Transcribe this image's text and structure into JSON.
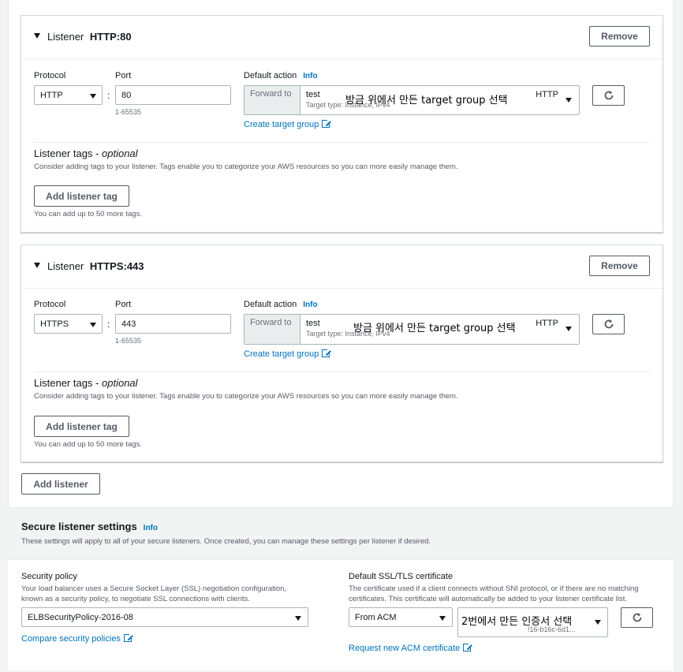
{
  "listeners": [
    {
      "title_prefix": "Listener",
      "title_main": "HTTP:80",
      "remove_label": "Remove",
      "protocol_label": "Protocol",
      "protocol_value": "HTTP",
      "port_label": "Port",
      "port_value": "80",
      "port_hint": "1-65535",
      "default_action_label": "Default action",
      "info_label": "Info",
      "forward_to_label": "Forward to",
      "target_group_name": "test",
      "target_group_sub": "Target type: Instance, IPv4",
      "target_group_protocol": "HTTP",
      "annotation": "방금 위에서 만든 target group 선택",
      "create_target_group_link": "Create target group",
      "tags_title": "Listener tags - ",
      "tags_optional": "optional",
      "tags_desc": "Consider adding tags to your listener. Tags enable you to categorize your AWS resources so you can more easily manage them.",
      "add_tag_label": "Add listener tag",
      "tags_hint": "You can add up to 50 more tags."
    },
    {
      "title_prefix": "Listener",
      "title_main": "HTTPS:443",
      "remove_label": "Remove",
      "protocol_label": "Protocol",
      "protocol_value": "HTTPS",
      "port_label": "Port",
      "port_value": "443",
      "port_hint": "1-65535",
      "default_action_label": "Default action",
      "info_label": "Info",
      "forward_to_label": "Forward to",
      "target_group_name": "test",
      "target_group_sub": "Target type: Instance, IPv4",
      "target_group_protocol": "HTTP",
      "annotation": "방금 위에서 만든 target group 선택",
      "create_target_group_link": "Create target group",
      "tags_title": "Listener tags - ",
      "tags_optional": "optional",
      "tags_desc": "Consider adding tags to your listener. Tags enable you to categorize your AWS resources so you can more easily manage them.",
      "add_tag_label": "Add listener tag",
      "tags_hint": "You can add up to 50 more tags."
    }
  ],
  "add_listener_label": "Add listener",
  "secure": {
    "title": "Secure listener settings",
    "info_label": "Info",
    "desc": "These settings will apply to all of your secure listeners. Once created, you can manage these settings per listener if desired.",
    "policy_label": "Security policy",
    "policy_desc_1": "Your load balancer uses a Secure Socket Layer (SSL) negotiation configuration,",
    "policy_desc_2": "known as a security policy, to negotiate SSL connections with clients.",
    "policy_value": "ELBSecurityPolicy-2016-08",
    "compare_link": "Compare security policies",
    "cert_label": "Default SSL/TLS certificate",
    "cert_desc_1": "The certificate used if a client connects without SNI protocol, or if there are no matching",
    "cert_desc_2": "certificates. This certificate will automatically be added to your listener certificate list.",
    "cert_source_value": "From ACM",
    "cert_annotation": "2번에서 만든 인증서 선택",
    "cert_sub": "!16-b16c-6d1...",
    "request_link": "Request new ACM certificate"
  }
}
